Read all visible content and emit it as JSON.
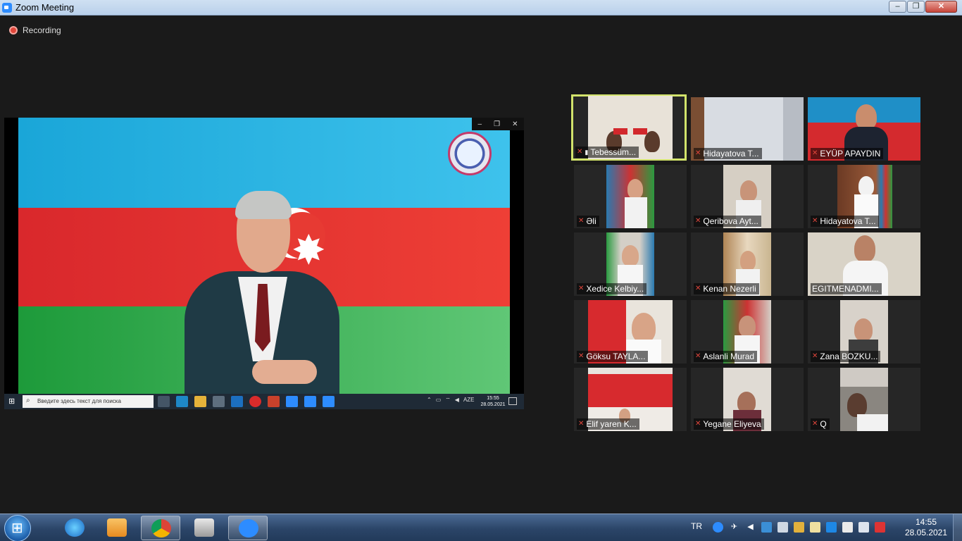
{
  "window": {
    "title": "Zoom Meeting",
    "min": "–",
    "max": "❐",
    "close": "✕"
  },
  "meeting": {
    "recording": "Recording"
  },
  "share": {
    "inner_controls": [
      "–",
      "❐",
      "✕"
    ],
    "search_placeholder": "Введите здесь текст для поиска",
    "tray_lang": "AZE",
    "time": "15:55",
    "date": "28.05.2021"
  },
  "participants": [
    {
      "name": "Tebessüm...",
      "muted": true,
      "pinned": true,
      "active": true
    },
    {
      "name": "Hidayatova T...",
      "muted": true
    },
    {
      "name": "EYÜP APAYDIN",
      "muted": true
    },
    {
      "name": "Əli",
      "muted": true
    },
    {
      "name": "Qeribova Ayt...",
      "muted": true
    },
    {
      "name": "Hidayatova T...",
      "muted": true
    },
    {
      "name": "Xedice Kelbiy...",
      "muted": true
    },
    {
      "name": "Kenan Nezerli",
      "muted": true
    },
    {
      "name": "EGITMENADMI...",
      "muted": false
    },
    {
      "name": "Göksu TAYLA...",
      "muted": true
    },
    {
      "name": "Aslanli Murad",
      "muted": true
    },
    {
      "name": "Zana BOZKU...",
      "muted": true
    },
    {
      "name": "Elif yaren   K...",
      "muted": true
    },
    {
      "name": "Yegane Eliyeva",
      "muted": true
    },
    {
      "name": "Q",
      "muted": true
    }
  ],
  "taskbar": {
    "apps": [
      "internet-explorer",
      "media-player",
      "chrome",
      "fax-printer",
      "zoom"
    ],
    "language": "TR",
    "time": "14:55",
    "date": "28.05.2021"
  }
}
